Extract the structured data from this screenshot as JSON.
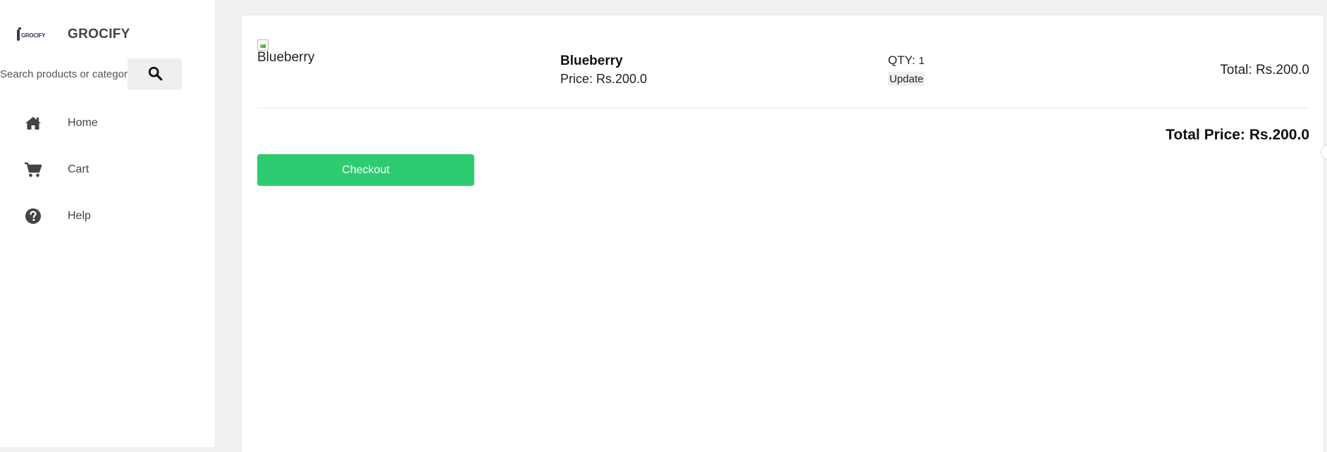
{
  "sidebar": {
    "logo_text": "GROCIFY",
    "brand_name": "GROCIFY",
    "search": {
      "placeholder": "Search products or categories",
      "button_icon": "search-icon"
    },
    "items": [
      {
        "label": "Home",
        "icon": "home-icon"
      },
      {
        "label": "Cart",
        "icon": "cart-icon"
      },
      {
        "label": "Help",
        "icon": "help-circle-icon"
      }
    ]
  },
  "cart": {
    "items": [
      {
        "image_alt": "Blueberry",
        "name": "Blueberry",
        "price": "Price: Rs.200.0",
        "qty_label": "QTY: ",
        "qty_value": "1",
        "update_label": "Update",
        "total": "Total: Rs.200.0"
      }
    ],
    "total_price": "Total Price: Rs.200.0",
    "checkout_label": "Checkout"
  },
  "colors": {
    "accent": "#2ecc71",
    "sidebar_bg": "#ffffff",
    "page_bg": "#f1f1f1"
  }
}
